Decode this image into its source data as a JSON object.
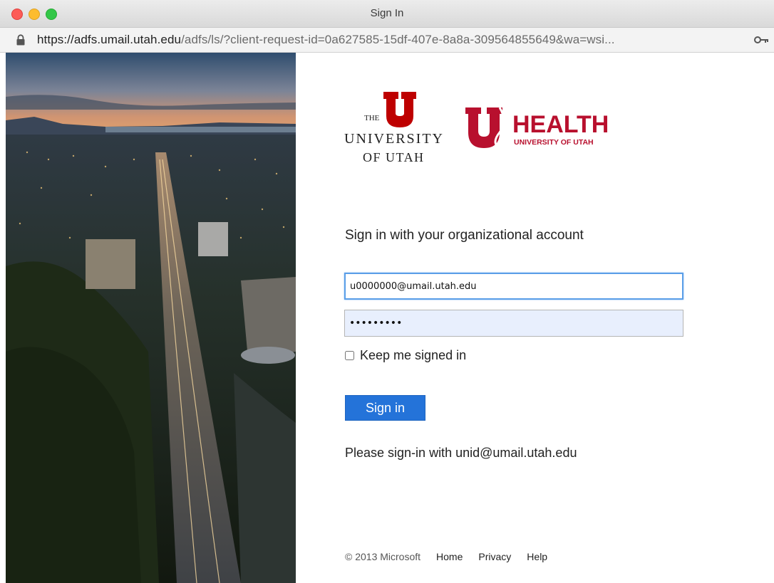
{
  "window": {
    "title": "Sign In"
  },
  "urlbar": {
    "host": "https://adfs.umail.utah.edu",
    "path": "/adfs/ls/?client-request-id=0a627585-15df-407e-8a8a-309564855649&wa=wsi..."
  },
  "logos": {
    "the": "THE",
    "university": "UNIVERSITY",
    "of_utah": "OF UTAH",
    "health": "HEALTH",
    "health_sub": "UNIVERSITY OF UTAH"
  },
  "form": {
    "heading": "Sign in with your organizational account",
    "username_value": "u0000000@umail.utah.edu",
    "password_value": "•••••••••",
    "keep_signed_in_label": "Keep me signed in",
    "keep_signed_in_checked": false,
    "signin_label": "Sign in",
    "hint": "Please sign-in with unid@umail.utah.edu"
  },
  "footer": {
    "copyright": "© 2013 Microsoft",
    "links": [
      "Home",
      "Privacy",
      "Help"
    ]
  },
  "colors": {
    "utah_red": "#be0000",
    "health_red": "#b8102e",
    "button_blue": "#2473d9"
  }
}
